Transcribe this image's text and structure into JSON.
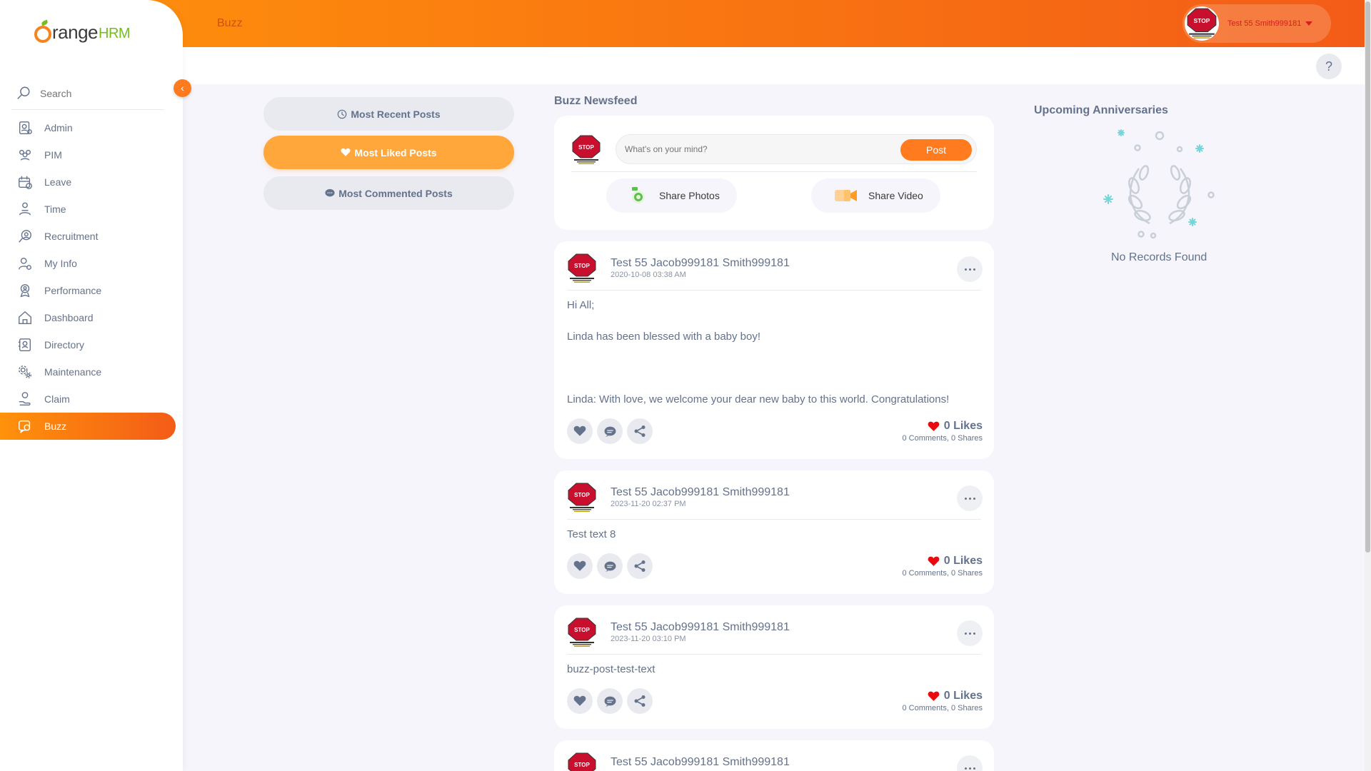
{
  "app": {
    "logo_word": "range",
    "logo_suffix": "HRM"
  },
  "header": {
    "breadcrumb": "Buzz",
    "user_name": "Test 55 Smith999181",
    "help_label": "?"
  },
  "sidebar": {
    "search_placeholder": "Search",
    "collapse_icon": "‹",
    "items": [
      {
        "label": "Admin",
        "icon": "admin-icon"
      },
      {
        "label": "PIM",
        "icon": "pim-icon"
      },
      {
        "label": "Leave",
        "icon": "leave-icon"
      },
      {
        "label": "Time",
        "icon": "time-icon"
      },
      {
        "label": "Recruitment",
        "icon": "recruitment-icon"
      },
      {
        "label": "My Info",
        "icon": "my-info-icon"
      },
      {
        "label": "Performance",
        "icon": "performance-icon"
      },
      {
        "label": "Dashboard",
        "icon": "dashboard-icon"
      },
      {
        "label": "Directory",
        "icon": "directory-icon"
      },
      {
        "label": "Maintenance",
        "icon": "maintenance-icon"
      },
      {
        "label": "Claim",
        "icon": "claim-icon"
      },
      {
        "label": "Buzz",
        "icon": "buzz-icon",
        "active": true
      }
    ]
  },
  "filters": {
    "most_recent": "Most Recent Posts",
    "most_liked": "Most Liked Posts",
    "most_commented": "Most Commented Posts",
    "active": "most_liked"
  },
  "feed": {
    "title": "Buzz Newsfeed",
    "composer": {
      "placeholder": "What's on your mind?",
      "post_button": "Post",
      "share_photos": "Share Photos",
      "share_video": "Share Video"
    },
    "posts": [
      {
        "author": "Test 55 Jacob999181 Smith999181",
        "date": "2020-10-08 03:38 AM",
        "lines": [
          "Hi All;",
          "Linda has been blessed with a baby boy!",
          "",
          "Linda: With love, we welcome your dear new baby to this world. Congratulations!"
        ],
        "likes": "0 Likes",
        "comments": "0 Comments",
        "shares": "0 Shares"
      },
      {
        "author": "Test 55 Jacob999181 Smith999181",
        "date": "2023-11-20 02:37 PM",
        "lines": [
          "Test text 8"
        ],
        "likes": "0 Likes",
        "comments": "0 Comments",
        "shares": "0 Shares"
      },
      {
        "author": "Test 55 Jacob999181 Smith999181",
        "date": "2023-11-20 03:10 PM",
        "lines": [
          "buzz-post-test-text"
        ],
        "likes": "0 Likes",
        "comments": "0 Comments",
        "shares": "0 Shares"
      },
      {
        "author": "Test 55 Jacob999181 Smith999181"
      }
    ]
  },
  "anniversaries": {
    "title": "Upcoming Anniversaries",
    "empty_text": "No Records Found"
  },
  "avatar": {
    "sign_text": "STOP"
  },
  "colors": {
    "brand_orange": "#ff7b1d",
    "gradient_start": "#ff920b",
    "gradient_end": "#f35c17",
    "text": "#64728c",
    "like_red": "#eb0910",
    "teal": "#76d5d9"
  }
}
